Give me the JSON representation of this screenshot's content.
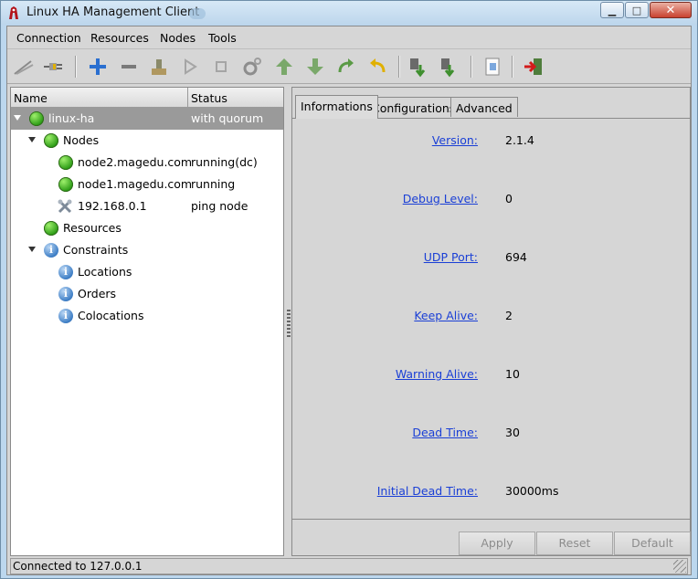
{
  "window": {
    "title": "Linux HA Management Client"
  },
  "menubar": {
    "items": [
      "Connection",
      "Resources",
      "Nodes",
      "Tools"
    ]
  },
  "toolbar": {
    "buttons": [
      "connect-icon",
      "disconnect-icon",
      "add-icon",
      "remove-icon",
      "cleanup-icon",
      "start-icon",
      "stop-icon",
      "settings-icon",
      "move-up-icon",
      "move-down-icon",
      "redo-icon",
      "undo-icon",
      "standby-icon",
      "active-icon",
      "view-xml-icon",
      "exit-icon"
    ]
  },
  "tree": {
    "columns": [
      "Name",
      "Status"
    ],
    "rows": [
      {
        "label": "linux-ha",
        "status": "with quorum",
        "icon": "green-status-icon",
        "level": 0,
        "expander": true,
        "selected": true
      },
      {
        "label": "Nodes",
        "status": "",
        "icon": "green-status-icon",
        "level": 1,
        "expander": true
      },
      {
        "label": "node2.magedu.com",
        "status": "running(dc)",
        "icon": "green-status-icon",
        "level": 2
      },
      {
        "label": "node1.magedu.com",
        "status": "running",
        "icon": "green-status-icon",
        "level": 2
      },
      {
        "label": "192.168.0.1",
        "status": "ping node",
        "icon": "tools-icon",
        "level": 2
      },
      {
        "label": "Resources",
        "status": "",
        "icon": "green-status-icon",
        "level": 1
      },
      {
        "label": "Constraints",
        "status": "",
        "icon": "info-icon",
        "level": 1,
        "expander": true
      },
      {
        "label": "Locations",
        "status": "",
        "icon": "info-icon",
        "level": 2
      },
      {
        "label": "Orders",
        "status": "",
        "icon": "info-icon",
        "level": 2
      },
      {
        "label": "Colocations",
        "status": "",
        "icon": "info-icon",
        "level": 2
      }
    ]
  },
  "tabs": [
    "Informations",
    "Configurations",
    "Advanced"
  ],
  "info": {
    "fields": [
      {
        "label": "Version:",
        "value": "2.1.4"
      },
      {
        "label": "Debug Level:",
        "value": "0"
      },
      {
        "label": "UDP Port:",
        "value": "694"
      },
      {
        "label": "Keep Alive:",
        "value": "2"
      },
      {
        "label": "Warning Alive:",
        "value": "10"
      },
      {
        "label": "Dead Time:",
        "value": "30"
      },
      {
        "label": "Initial Dead Time:",
        "value": "30000ms"
      }
    ]
  },
  "buttons": {
    "apply": "Apply",
    "reset": "Reset",
    "default": "Default"
  },
  "status": {
    "text": "Connected to 127.0.0.1"
  },
  "colors": {
    "link": "#1a3fd6",
    "selected_row": "#9a9a9a"
  }
}
